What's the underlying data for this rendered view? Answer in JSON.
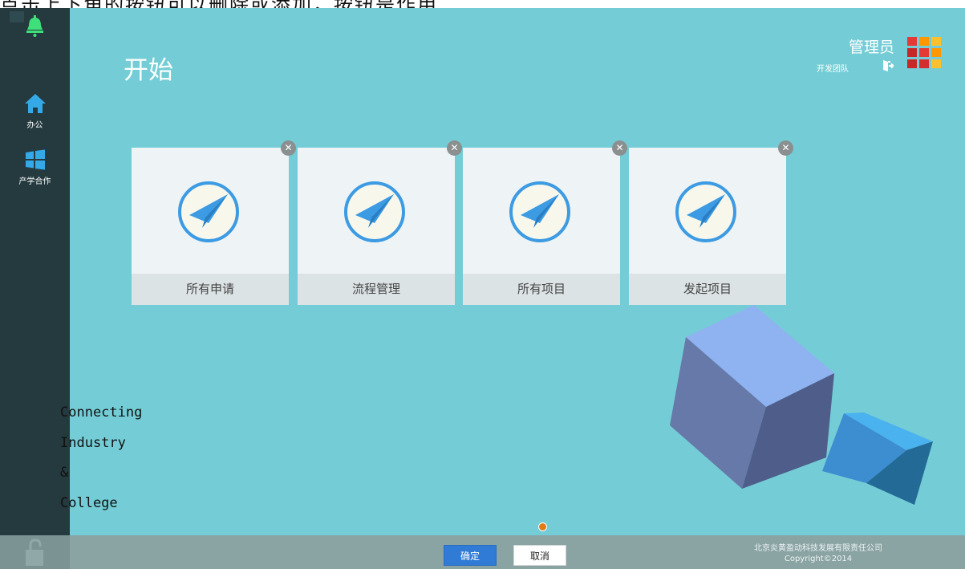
{
  "top_caption": "点击上下角的按钮可以删除或添加，按钮是作用",
  "sidebar": {
    "items": [
      {
        "label": ""
      },
      {
        "label": "办公"
      },
      {
        "label": "产学合作"
      }
    ]
  },
  "header": {
    "title": "开始",
    "user_name": "管理员",
    "user_team": "开发团队"
  },
  "tiles": [
    {
      "label": "所有申请"
    },
    {
      "label": "流程管理"
    },
    {
      "label": "所有项目"
    },
    {
      "label": "发起项目"
    }
  ],
  "slogan": [
    "Connecting",
    "Industry",
    "&",
    "College"
  ],
  "footer": {
    "ok_label": "确定",
    "cancel_label": "取消",
    "company": "北京炎黄盈动科技发展有限责任公司",
    "copyright": "Copyright©2014"
  },
  "colors": {
    "accent": "#74cdd6",
    "sidebar": "#243a3f",
    "primary_button": "#2f7bd6",
    "tile_icon_ring": "#3c9be3",
    "apps_grid": [
      "#e53935",
      "#ff9800",
      "#fbc02d",
      "#c62828",
      "#e53935",
      "#ff9800",
      "#c62828",
      "#d32f2f",
      "#fbc02d"
    ]
  },
  "icons": {
    "sidebar": [
      "bell-icon",
      "home-icon",
      "windows-icon"
    ],
    "tile": "paper-plane-icon",
    "tile_remove": "close-icon",
    "footer": "lock-icon",
    "header": [
      "exit-icon",
      "apps-grid-icon"
    ]
  }
}
